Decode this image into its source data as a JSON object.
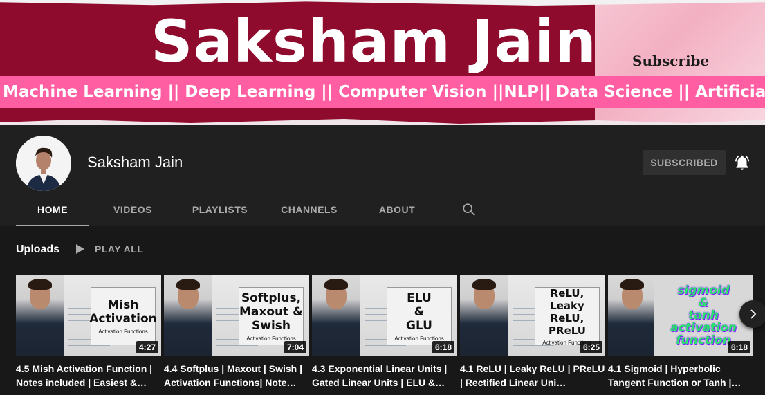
{
  "banner": {
    "title": "Saksham Jain",
    "subscribe": "Subscribe",
    "tagline": "Machine Learning || Deep Learning || Computer Vision ||NLP|| Data Science || Artificial Intelligence"
  },
  "channel": {
    "name": "Saksham Jain",
    "subscribe_button": "SUBSCRIBED"
  },
  "tabs": [
    {
      "label": "HOME",
      "active": true
    },
    {
      "label": "VIDEOS"
    },
    {
      "label": "PLAYLISTS"
    },
    {
      "label": "CHANNELS"
    },
    {
      "label": "ABOUT"
    }
  ],
  "uploads": {
    "label": "Uploads",
    "play_all": "PLAY ALL",
    "videos": [
      {
        "card": "Mish\nActivation",
        "card_sub": "Activation Functions",
        "duration": "4:27",
        "title": "4.5 Mish Activation Function | Notes included | Easiest &…"
      },
      {
        "card": "Softplus,\nMaxout &\nSwish",
        "card_sub": "Activation Functions",
        "duration": "7:04",
        "title": "4.4 Softplus | Maxout | Swish | Activation Functions| Note…"
      },
      {
        "card": "ELU\n&\nGLU",
        "card_sub": "Activation Functions",
        "duration": "6:18",
        "title": "4.3 Exponential Linear Units | Gated Linear Units | ELU &…"
      },
      {
        "card": "ReLU,\nLeaky ReLU,\nPReLU",
        "card_sub": "Activation Functions",
        "duration": "6:25",
        "title": "4.1 ReLU | Leaky ReLU | PReLU | Rectified Linear Uni…"
      },
      {
        "card": "sigmoid\n&\ntanh\nactivation\nfunction",
        "card_sub": "",
        "duration": "6:18",
        "title": "4.1 Sigmoid | Hyperbolic Tangent Function or Tanh |…"
      }
    ]
  },
  "colors": {
    "background": "#181818",
    "header": "#202020",
    "banner": "#8e0b2e",
    "banner_strip": "#ff5fa2"
  }
}
